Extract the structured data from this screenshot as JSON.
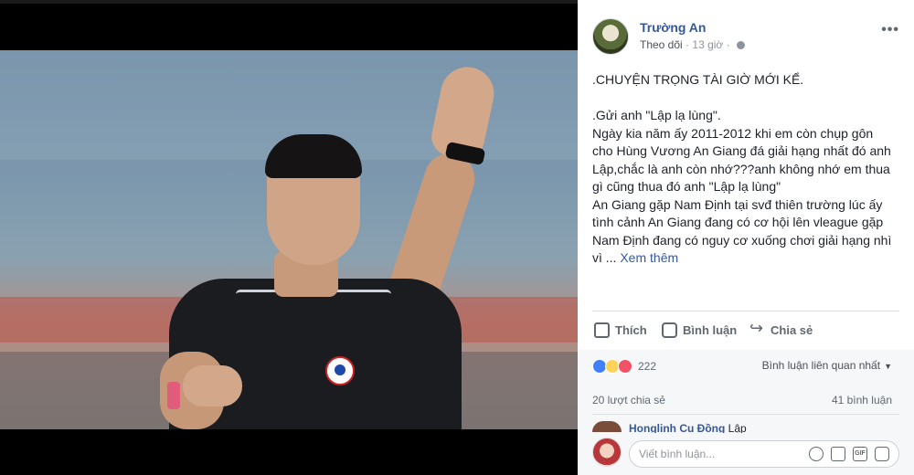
{
  "post": {
    "author": "Trường An",
    "follow_label": "Theo dõi",
    "time": "13 giờ",
    "more_label": "•••",
    "text_lines": [
      ".CHUYỆN TRỌNG TÀI GIỜ MỚI KỂ.",
      "",
      ".Gửi anh \"Lập lạ lùng\".",
      "Ngày kia năm ấy 2011-2012 khi em còn chụp gôn",
      "cho Hùng Vương An Giang đá giải hạng nhất đó anh",
      "Lập,chắc là anh còn nhớ???anh không nhớ em thua",
      "gì cũng thua đó anh \"Lập lạ lùng\"",
      "An Giang gặp Nam Định tại svđ thiên trường lúc ấy",
      "tình cảnh An Giang đang có cơ hội lên vleague gặp",
      "Nam Định đang có nguy cơ xuống chơi giải hạng nhì",
      "vì ..."
    ],
    "see_more": "Xem thêm"
  },
  "actions": {
    "like": "Thích",
    "comment": "Bình luận",
    "share": "Chia sẻ"
  },
  "stats": {
    "reactions_count": "222",
    "sort_label": "Bình luận liên quan nhất",
    "shares": "20 lượt chia sẻ",
    "comments": "41 bình luận"
  },
  "comment_preview": {
    "name": "Honglinh Cu Đồng",
    "text": "Lập"
  },
  "composer": {
    "placeholder": "Viết bình luận..."
  },
  "colors": {
    "link": "#365899",
    "like_reaction": "#4080ff",
    "haha_reaction": "#fbd35b",
    "love_reaction": "#f25268"
  }
}
